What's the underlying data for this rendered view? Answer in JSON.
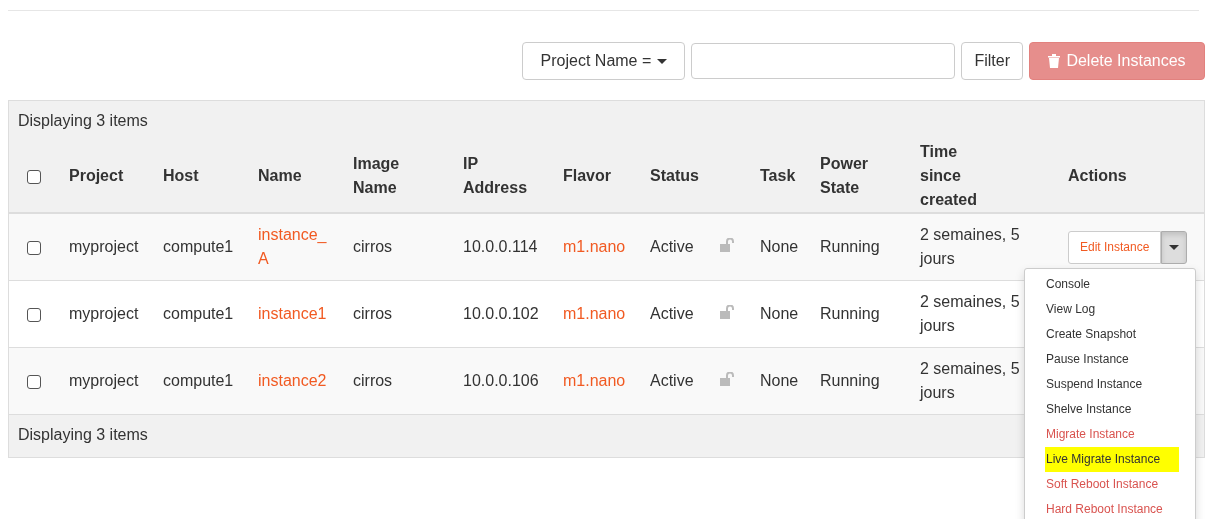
{
  "toolbar": {
    "filter_field_menu": "Project Name =",
    "filter_button": "Filter",
    "delete_button": {
      "label": "Delete Instances",
      "disabled": true
    }
  },
  "table": {
    "summary_top": "Displaying 3 items",
    "select_all": {
      "checked": false
    },
    "columns": [
      "Project",
      "Host",
      "Name",
      "Image Name",
      "IP Address",
      "Flavor",
      "Status",
      "",
      "Task",
      "Power State",
      "Time since created",
      "Actions"
    ],
    "rows": [
      {
        "checked": false,
        "project": "myproject",
        "host": "compute1",
        "name": "instance_ A",
        "image": "cirros",
        "ip": "10.0.0.114",
        "flavor": "m1.nano",
        "status": "Active",
        "locked": false,
        "task": "None",
        "power": "Running",
        "time": "2 semaines, 5 jours",
        "action": "Edit Instance"
      },
      {
        "checked": false,
        "project": "myproject",
        "host": "compute1",
        "name": "instance1",
        "image": "cirros",
        "ip": "10.0.0.102",
        "flavor": "m1.nano",
        "status": "Active",
        "locked": false,
        "task": "None",
        "power": "Running",
        "time": "2 semaines, 5 jours"
      },
      {
        "checked": false,
        "project": "myproject",
        "host": "compute1",
        "name": "instance2",
        "image": "cirros",
        "ip": "10.0.0.106",
        "flavor": "m1.nano",
        "status": "Active",
        "locked": false,
        "task": "None",
        "power": "Running",
        "time": "2 semaines, 5 jours"
      }
    ],
    "summary_bottom": "Displaying 3 items"
  },
  "actions_menu": {
    "expanded": true,
    "items": [
      {
        "label": "Console",
        "kind": "normal",
        "highlighted": false
      },
      {
        "label": "View Log",
        "kind": "normal",
        "highlighted": false
      },
      {
        "label": "Create Snapshot",
        "kind": "normal",
        "highlighted": false
      },
      {
        "label": "Pause Instance",
        "kind": "normal",
        "highlighted": false
      },
      {
        "label": "Suspend Instance",
        "kind": "normal",
        "highlighted": false
      },
      {
        "label": "Shelve Instance",
        "kind": "normal",
        "highlighted": false
      },
      {
        "label": "Migrate Instance",
        "kind": "danger",
        "highlighted": false
      },
      {
        "label": "Live Migrate Instance",
        "kind": "normal",
        "highlighted": true
      },
      {
        "label": "Soft Reboot Instance",
        "kind": "danger",
        "highlighted": false
      },
      {
        "label": "Hard Reboot Instance",
        "kind": "danger",
        "highlighted": false
      }
    ]
  }
}
